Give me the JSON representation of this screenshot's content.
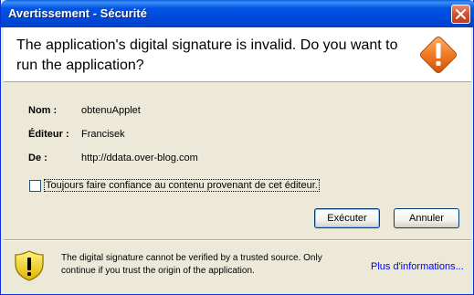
{
  "window": {
    "title": "Avertissement - Sécurité",
    "close_icon": "close-icon"
  },
  "header": {
    "message": "The application's digital signature is invalid.  Do you want to run the application?",
    "icon": "warning-diamond-icon"
  },
  "details": [
    {
      "label": "Nom :",
      "value": "obtenuApplet"
    },
    {
      "label": "Éditeur :",
      "value": "Francisek"
    },
    {
      "label": "De :",
      "value": "http://ddata.over-blog.com"
    }
  ],
  "trust_checkbox": {
    "label": "Toujours faire confiance au contenu provenant de cet éditeur.",
    "checked": false
  },
  "buttons": {
    "run": "Exécuter",
    "cancel": "Annuler"
  },
  "footer": {
    "icon": "shield-warning-icon",
    "message": "The digital signature cannot be verified by a trusted source.  Only continue if you trust the origin of the application.",
    "more_info": "Plus d'informations..."
  },
  "colors": {
    "title_bar": "#0055e5",
    "dialog_bg": "#ece9d8",
    "warning_orange": "#e8731f",
    "shield_yellow": "#f5d000",
    "link": "#0000ee"
  }
}
